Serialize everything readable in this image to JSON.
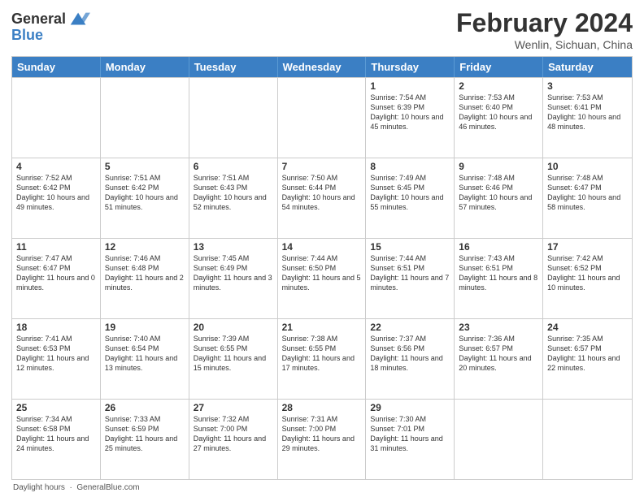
{
  "header": {
    "logo_general": "General",
    "logo_blue": "Blue",
    "month_year": "February 2024",
    "location": "Wenlin, Sichuan, China"
  },
  "days_of_week": [
    "Sunday",
    "Monday",
    "Tuesday",
    "Wednesday",
    "Thursday",
    "Friday",
    "Saturday"
  ],
  "weeks": [
    [
      {
        "day": "",
        "info": ""
      },
      {
        "day": "",
        "info": ""
      },
      {
        "day": "",
        "info": ""
      },
      {
        "day": "",
        "info": ""
      },
      {
        "day": "1",
        "info": "Sunrise: 7:54 AM\nSunset: 6:39 PM\nDaylight: 10 hours and 45 minutes."
      },
      {
        "day": "2",
        "info": "Sunrise: 7:53 AM\nSunset: 6:40 PM\nDaylight: 10 hours and 46 minutes."
      },
      {
        "day": "3",
        "info": "Sunrise: 7:53 AM\nSunset: 6:41 PM\nDaylight: 10 hours and 48 minutes."
      }
    ],
    [
      {
        "day": "4",
        "info": "Sunrise: 7:52 AM\nSunset: 6:42 PM\nDaylight: 10 hours and 49 minutes."
      },
      {
        "day": "5",
        "info": "Sunrise: 7:51 AM\nSunset: 6:42 PM\nDaylight: 10 hours and 51 minutes."
      },
      {
        "day": "6",
        "info": "Sunrise: 7:51 AM\nSunset: 6:43 PM\nDaylight: 10 hours and 52 minutes."
      },
      {
        "day": "7",
        "info": "Sunrise: 7:50 AM\nSunset: 6:44 PM\nDaylight: 10 hours and 54 minutes."
      },
      {
        "day": "8",
        "info": "Sunrise: 7:49 AM\nSunset: 6:45 PM\nDaylight: 10 hours and 55 minutes."
      },
      {
        "day": "9",
        "info": "Sunrise: 7:48 AM\nSunset: 6:46 PM\nDaylight: 10 hours and 57 minutes."
      },
      {
        "day": "10",
        "info": "Sunrise: 7:48 AM\nSunset: 6:47 PM\nDaylight: 10 hours and 58 minutes."
      }
    ],
    [
      {
        "day": "11",
        "info": "Sunrise: 7:47 AM\nSunset: 6:47 PM\nDaylight: 11 hours and 0 minutes."
      },
      {
        "day": "12",
        "info": "Sunrise: 7:46 AM\nSunset: 6:48 PM\nDaylight: 11 hours and 2 minutes."
      },
      {
        "day": "13",
        "info": "Sunrise: 7:45 AM\nSunset: 6:49 PM\nDaylight: 11 hours and 3 minutes."
      },
      {
        "day": "14",
        "info": "Sunrise: 7:44 AM\nSunset: 6:50 PM\nDaylight: 11 hours and 5 minutes."
      },
      {
        "day": "15",
        "info": "Sunrise: 7:44 AM\nSunset: 6:51 PM\nDaylight: 11 hours and 7 minutes."
      },
      {
        "day": "16",
        "info": "Sunrise: 7:43 AM\nSunset: 6:51 PM\nDaylight: 11 hours and 8 minutes."
      },
      {
        "day": "17",
        "info": "Sunrise: 7:42 AM\nSunset: 6:52 PM\nDaylight: 11 hours and 10 minutes."
      }
    ],
    [
      {
        "day": "18",
        "info": "Sunrise: 7:41 AM\nSunset: 6:53 PM\nDaylight: 11 hours and 12 minutes."
      },
      {
        "day": "19",
        "info": "Sunrise: 7:40 AM\nSunset: 6:54 PM\nDaylight: 11 hours and 13 minutes."
      },
      {
        "day": "20",
        "info": "Sunrise: 7:39 AM\nSunset: 6:55 PM\nDaylight: 11 hours and 15 minutes."
      },
      {
        "day": "21",
        "info": "Sunrise: 7:38 AM\nSunset: 6:55 PM\nDaylight: 11 hours and 17 minutes."
      },
      {
        "day": "22",
        "info": "Sunrise: 7:37 AM\nSunset: 6:56 PM\nDaylight: 11 hours and 18 minutes."
      },
      {
        "day": "23",
        "info": "Sunrise: 7:36 AM\nSunset: 6:57 PM\nDaylight: 11 hours and 20 minutes."
      },
      {
        "day": "24",
        "info": "Sunrise: 7:35 AM\nSunset: 6:57 PM\nDaylight: 11 hours and 22 minutes."
      }
    ],
    [
      {
        "day": "25",
        "info": "Sunrise: 7:34 AM\nSunset: 6:58 PM\nDaylight: 11 hours and 24 minutes."
      },
      {
        "day": "26",
        "info": "Sunrise: 7:33 AM\nSunset: 6:59 PM\nDaylight: 11 hours and 25 minutes."
      },
      {
        "day": "27",
        "info": "Sunrise: 7:32 AM\nSunset: 7:00 PM\nDaylight: 11 hours and 27 minutes."
      },
      {
        "day": "28",
        "info": "Sunrise: 7:31 AM\nSunset: 7:00 PM\nDaylight: 11 hours and 29 minutes."
      },
      {
        "day": "29",
        "info": "Sunrise: 7:30 AM\nSunset: 7:01 PM\nDaylight: 11 hours and 31 minutes."
      },
      {
        "day": "",
        "info": ""
      },
      {
        "day": "",
        "info": ""
      }
    ]
  ],
  "footer": {
    "daylight_hours": "Daylight hours",
    "site": "GeneralBlue.com"
  }
}
